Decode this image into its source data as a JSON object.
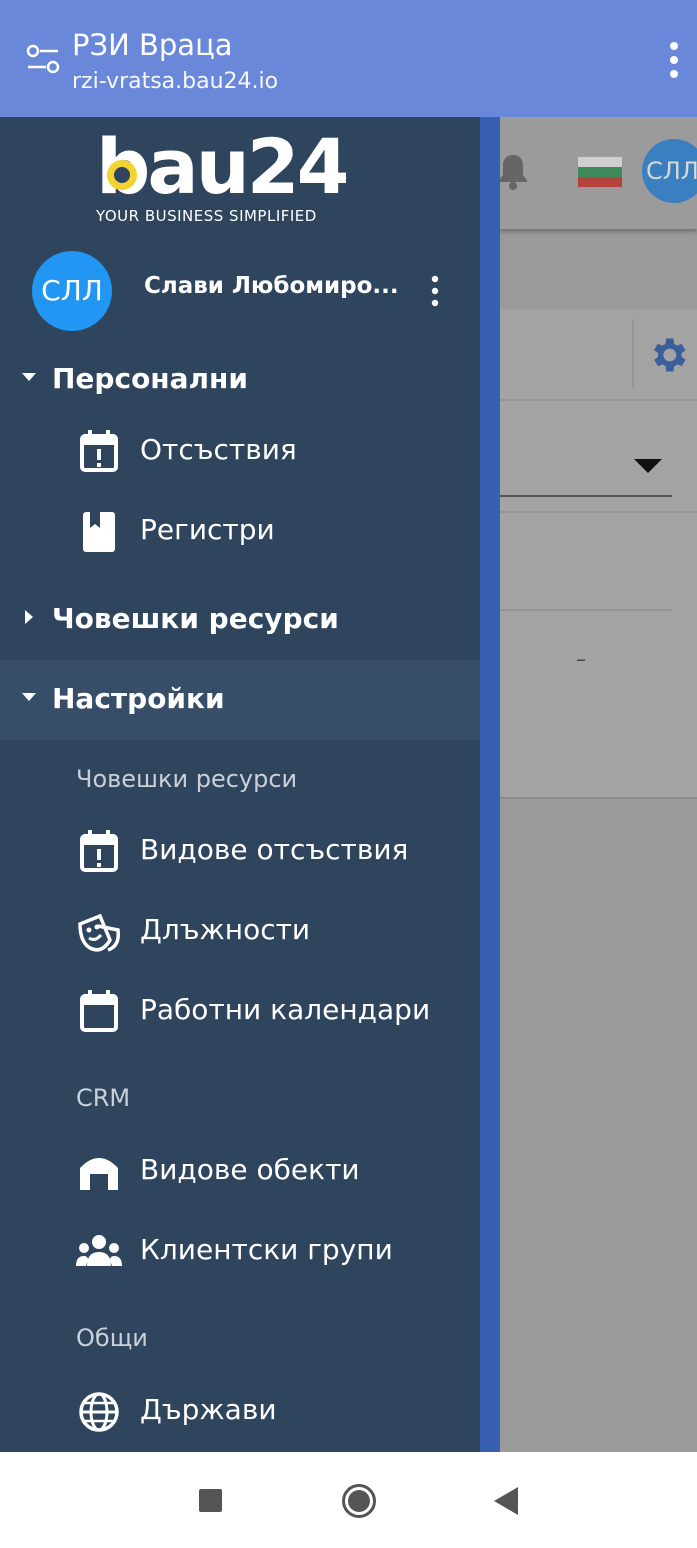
{
  "appbar": {
    "title": "РЗИ Враца",
    "subtitle": "rzi-vratsa.bau24.io",
    "icons": [
      "tune-icon",
      "more-vert-icon"
    ]
  },
  "colors": {
    "appbar": "#6a88d9",
    "drawer": "#2f445d",
    "drawer_active": "#374e69",
    "accent": "#2196f3",
    "logo_accent": "#f2d332"
  },
  "drawer": {
    "logo": {
      "text": "bau24",
      "tagline": "YOUR BUSINESS SIMPLIFIED"
    },
    "user": {
      "initials": "СЛЛ",
      "name": "Слави Любомиро..."
    },
    "sections": [
      {
        "label": "Персонални",
        "expanded": true,
        "items": [
          {
            "label": "Отсъствия",
            "icon": "calendar-alert-icon"
          },
          {
            "label": "Регистри",
            "icon": "book-icon"
          }
        ]
      },
      {
        "label": "Човешки ресурси",
        "expanded": false,
        "items": []
      },
      {
        "label": "Настройки",
        "expanded": true,
        "groups": [
          {
            "title": "Човешки ресурси",
            "items": [
              {
                "label": "Видове отсъствия",
                "icon": "calendar-alert-icon"
              },
              {
                "label": "Длъжности",
                "icon": "theater-masks-icon"
              },
              {
                "label": "Работни календари",
                "icon": "calendar-icon"
              }
            ]
          },
          {
            "title": "CRM",
            "items": [
              {
                "label": "Видове обекти",
                "icon": "warehouse-icon"
              },
              {
                "label": "Клиентски групи",
                "icon": "group-icon"
              }
            ]
          },
          {
            "title": "Общи",
            "items": [
              {
                "label": "Държави",
                "icon": "globe-icon"
              }
            ]
          }
        ]
      }
    ]
  },
  "background": {
    "avatar_initials": "СЛЛ",
    "placeholder": "–"
  }
}
